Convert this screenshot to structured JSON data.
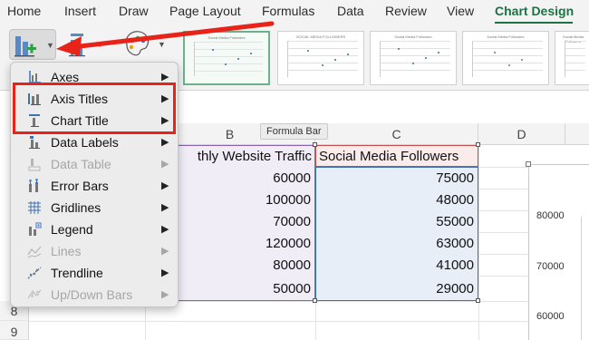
{
  "ribbon_tabs": [
    "Home",
    "Insert",
    "Draw",
    "Page Layout",
    "Formulas",
    "Data",
    "Review",
    "View",
    "Chart Design"
  ],
  "active_tab": "Chart Design",
  "ribbon": {
    "add_chart_element_icon": "add-chart-element-icon",
    "quick_layout_icon": "quick-layout-icon",
    "change_colors_icon": "change-colors-icon",
    "styles": [
      {
        "title": "Social Media Followers"
      },
      {
        "title": "SOCIAL MEDIA FOLLOWERS"
      },
      {
        "title": "Social Media Followers"
      },
      {
        "title": "Social Media Followers"
      },
      {
        "title": "Social Media Followers"
      }
    ]
  },
  "tooltip": "Formula Bar",
  "columns": [
    "B",
    "C",
    "D"
  ],
  "row_numbers": [
    "8",
    "9"
  ],
  "table": {
    "header_b": "thly Website Traffic",
    "header_c": "Social Media Followers",
    "rows": [
      {
        "b": "60000",
        "c": "75000"
      },
      {
        "b": "100000",
        "c": "48000"
      },
      {
        "b": "70000",
        "c": "55000"
      },
      {
        "b": "120000",
        "c": "63000"
      },
      {
        "b": "80000",
        "c": "41000"
      },
      {
        "b": "50000",
        "c": "29000"
      }
    ]
  },
  "chart_axis_ticks": [
    "80000",
    "70000",
    "60000"
  ],
  "menu": {
    "items": [
      {
        "label": "Axes",
        "icon": "axes-icon",
        "disabled": false
      },
      {
        "label": "Axis Titles",
        "icon": "axis-titles-icon",
        "disabled": false
      },
      {
        "label": "Chart Title",
        "icon": "chart-title-icon",
        "disabled": false
      },
      {
        "label": "Data Labels",
        "icon": "data-labels-icon",
        "disabled": false
      },
      {
        "label": "Data Table",
        "icon": "data-table-icon",
        "disabled": true
      },
      {
        "label": "Error Bars",
        "icon": "error-bars-icon",
        "disabled": false
      },
      {
        "label": "Gridlines",
        "icon": "gridlines-icon",
        "disabled": false
      },
      {
        "label": "Legend",
        "icon": "legend-icon",
        "disabled": false
      },
      {
        "label": "Lines",
        "icon": "lines-icon",
        "disabled": true
      },
      {
        "label": "Trendline",
        "icon": "trendline-icon",
        "disabled": false
      },
      {
        "label": "Up/Down Bars",
        "icon": "up-down-bars-icon",
        "disabled": true
      }
    ]
  },
  "colors": {
    "accent": "#1e7145",
    "highlight": "#e8231a",
    "range_b": "#8a63b4",
    "range_c": "#3f6fb5",
    "header_c": "#c0504d"
  }
}
